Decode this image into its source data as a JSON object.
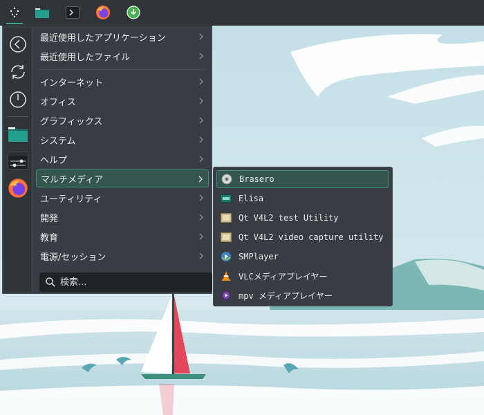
{
  "taskbar": {
    "items": [
      {
        "name": "application-launcher-icon",
        "active": true
      },
      {
        "name": "file-manager-icon"
      },
      {
        "name": "terminal-icon"
      },
      {
        "name": "firefox-icon"
      },
      {
        "name": "download-icon"
      }
    ]
  },
  "favorites": [
    {
      "name": "back-icon"
    },
    {
      "name": "refresh-icon"
    },
    {
      "name": "power-icon"
    },
    {
      "name": "file-manager-icon"
    },
    {
      "name": "settings-icon"
    },
    {
      "name": "firefox-icon"
    }
  ],
  "menu": {
    "categories": [
      {
        "label": "最近使用したアプリケーション"
      },
      {
        "label": "最近使用したファイル"
      },
      {
        "label": "インターネット"
      },
      {
        "label": "オフィス"
      },
      {
        "label": "グラフィックス"
      },
      {
        "label": "システム"
      },
      {
        "label": "ヘルプ"
      },
      {
        "label": "マルチメディア",
        "selected": true
      },
      {
        "label": "ユーティリティ"
      },
      {
        "label": "開発"
      },
      {
        "label": "教育"
      },
      {
        "label": "電源/セッション"
      }
    ],
    "search_placeholder": "検索..."
  },
  "submenu": {
    "items": [
      {
        "label": "Brasero",
        "icon": "disc-icon",
        "selected": true
      },
      {
        "label": "Elisa",
        "icon": "music-player-icon"
      },
      {
        "label": "Qt V4L2 test Utility",
        "icon": "webcam-icon"
      },
      {
        "label": "Qt V4L2 video capture utility",
        "icon": "webcam-icon"
      },
      {
        "label": "SMPlayer",
        "icon": "smplayer-icon"
      },
      {
        "label": "VLCメディアプレイヤー",
        "icon": "vlc-icon"
      },
      {
        "label": "mpv メディアプレイヤー",
        "icon": "mpv-icon"
      }
    ]
  },
  "colors": {
    "accent": "#3c8f7d",
    "panel": "#2f3438",
    "menu_bg": "#373d42"
  }
}
